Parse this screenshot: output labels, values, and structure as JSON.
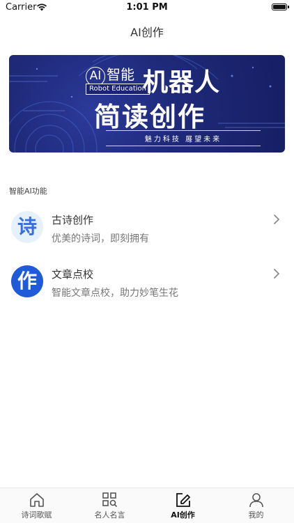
{
  "status": {
    "carrier": "Carrier",
    "time": "1:01 PM"
  },
  "nav": {
    "title": "AI创作"
  },
  "banner": {
    "ai_circle": "AI",
    "ai_text": "智能",
    "robot": "Robot Education",
    "line1": "机器人",
    "line2": "简读创作",
    "sub": "魅力科技    展望未来"
  },
  "section": {
    "title": "智能AI功能"
  },
  "features": [
    {
      "glyph": "诗",
      "title": "古诗创作",
      "subtitle": "优美的诗词，即刻拥有"
    },
    {
      "glyph": "作",
      "title": "文章点校",
      "subtitle": "智能文章点校，助力妙笔生花"
    }
  ],
  "tabs": [
    {
      "label": "诗词歌赋",
      "icon": "home-icon"
    },
    {
      "label": "名人名言",
      "icon": "grid-search-icon"
    },
    {
      "label": "AI创作",
      "icon": "edit-icon"
    },
    {
      "label": "我的",
      "icon": "user-icon"
    }
  ],
  "colors": {
    "accent": "#1f5bd8",
    "banner": "#1f2a7a"
  }
}
